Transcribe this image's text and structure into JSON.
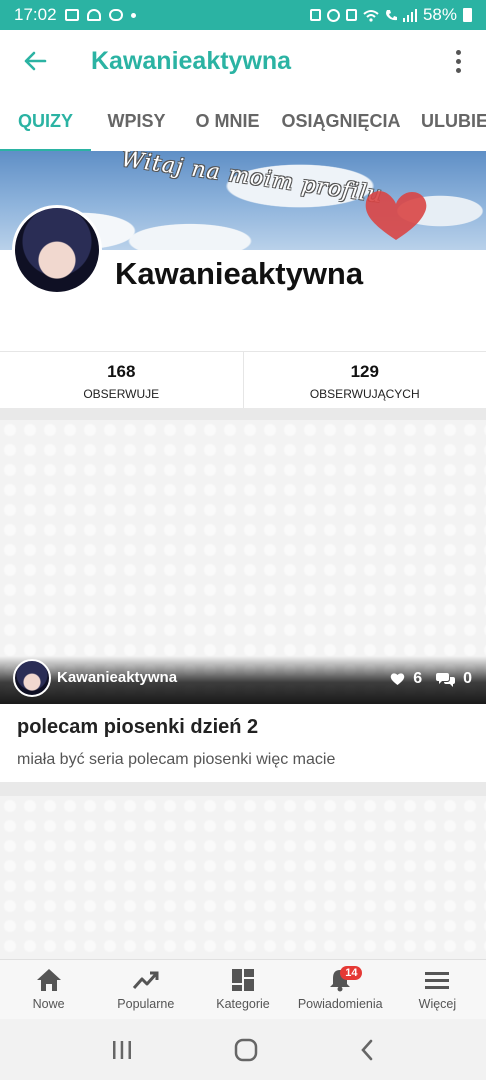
{
  "status_bar": {
    "time": "17:02",
    "battery": "58%",
    "icons_left": [
      "image-icon",
      "weather-icon",
      "cloud-icon",
      "dot-icon"
    ],
    "icons_right": [
      "save-icon",
      "alarm-icon",
      "mute-icon",
      "wifi-icon",
      "call-icon",
      "signal-icon",
      "battery-icon"
    ]
  },
  "app_bar": {
    "title": "Kawanieaktywna",
    "back_icon": "arrow-left-icon",
    "more_icon": "more-vertical-icon"
  },
  "tabs": [
    {
      "label": "QUIZY",
      "active": true
    },
    {
      "label": "WPISY",
      "active": false
    },
    {
      "label": "O MNIE",
      "active": false
    },
    {
      "label": "OSIĄGNIĘCIA",
      "active": false
    },
    {
      "label": "ULUBIEI",
      "active": false
    }
  ],
  "banner": {
    "text": "Witaj na moim profilu"
  },
  "profile": {
    "name": "Kawanieaktywna",
    "stats": [
      {
        "value": "168",
        "label": "OBSERWUJE"
      },
      {
        "value": "129",
        "label": "OBSERWUJĄCYCH"
      }
    ]
  },
  "quizzes": [
    {
      "author": "Kawanieaktywna",
      "likes": "6",
      "comments": "0",
      "title": "polecam piosenki dzień 2",
      "description": "miała być seria polecam piosenki więc macie"
    }
  ],
  "bottom_nav": [
    {
      "label": "Nowe",
      "icon": "home-icon"
    },
    {
      "label": "Popularne",
      "icon": "trending-icon"
    },
    {
      "label": "Kategorie",
      "icon": "grid-icon"
    },
    {
      "label": "Powiadomienia",
      "icon": "bell-icon",
      "badge": "14"
    },
    {
      "label": "Więcej",
      "icon": "menu-icon"
    }
  ],
  "colors": {
    "accent": "#2bb3a3",
    "badge": "#e53935"
  }
}
